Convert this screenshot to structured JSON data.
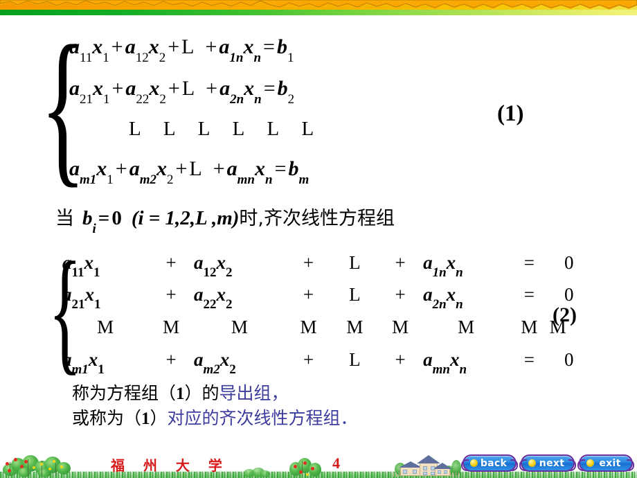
{
  "slide": {
    "page_number": "4",
    "footer_university": "福 州 大 学",
    "accent_blue": "#3d3d9e",
    "accent_red": "#d71a1a"
  },
  "system1": {
    "tag": "(1)",
    "rows": [
      {
        "a1": "a",
        "a1sub": "11",
        "x1": "x",
        "x1sub": "1",
        "op1": "+",
        "a2": "a",
        "a2sub": "12",
        "x2": "x",
        "x2sub": "2",
        "op2": "+",
        "ell": "L",
        "op3": "+",
        "a3": "a",
        "a3sub": "1n",
        "x3": "x",
        "x3sub": "n",
        "eq": "=",
        "rhs": "b",
        "rhssub": "1"
      },
      {
        "a1": "a",
        "a1sub": "21",
        "x1": "x",
        "x1sub": "1",
        "op1": "+",
        "a2": "a",
        "a2sub": "22",
        "x2": "x",
        "x2sub": "2",
        "op2": "+",
        "ell": "L",
        "op3": "+",
        "a3": "a",
        "a3sub": "2n",
        "x3": "x",
        "x3sub": "n",
        "eq": "=",
        "rhs": "b",
        "rhssub": "2"
      },
      {
        "a1": "a",
        "a1sub": "m1",
        "x1": "x",
        "x1sub": "1",
        "op1": "+",
        "a2": "a",
        "a2sub": "m2",
        "x2": "x",
        "x2sub": "2",
        "op2": "+",
        "ell": "L",
        "op3": "+",
        "a3": "a",
        "a3sub": "mn",
        "x3": "x",
        "x3sub": "n",
        "eq": "=",
        "rhs": "b",
        "rhssub": "m"
      }
    ],
    "dots_row": "L L L L L L"
  },
  "condition_line": {
    "prefix": "当",
    "b": "b",
    "bsub": "i",
    "eq": "=",
    "zero": "0",
    "range": "(i = 1,2,L ,m)",
    "suffix": "时,齐次线性方程组"
  },
  "system2": {
    "tag": "(2)",
    "rows": [
      {
        "a": "a",
        "asub": "11",
        "x": "x",
        "xsub": "1",
        "plus1": "+",
        "a2": "a",
        "a2sub": "12",
        "x2": "x",
        "x2sub": "2",
        "plus2": "+",
        "ell": "L",
        "plus3": "+",
        "an": "a",
        "ansub": "1n",
        "xn": "x",
        "xnsub": "n",
        "eq": "=",
        "rhs": "0"
      },
      {
        "a": "a",
        "asub": "21",
        "x": "x",
        "xsub": "1",
        "plus1": "+",
        "a2": "a",
        "a2sub": "22",
        "x2": "x",
        "x2sub": "2",
        "plus2": "+",
        "ell": "L",
        "plus3": "+",
        "an": "a",
        "ansub": "2n",
        "xn": "x",
        "xnsub": "n",
        "eq": "=",
        "rhs": "0"
      },
      {
        "a": "a",
        "asub": "m1",
        "x": "x",
        "xsub": "1",
        "plus1": "+",
        "a2": "a",
        "a2sub": "m2",
        "x2": "x",
        "x2sub": "2",
        "plus2": "+",
        "ell": "L",
        "plus3": "+",
        "an": "a",
        "ansub": "mn",
        "xn": "x",
        "xnsub": "n",
        "eq": "=",
        "rhs": "0"
      }
    ],
    "vdots": [
      "M",
      "M",
      "M",
      "M",
      "M",
      "M",
      "M",
      "M",
      "M"
    ]
  },
  "closing": {
    "line1_a": "称为方程组（",
    "line1_num": "1",
    "line1_b": "）的",
    "line1_hl": "导出组，",
    "line2_a": "或称为（",
    "line2_num": "1",
    "line2_b": "）",
    "line2_hl": "对应的齐次线性方程组．"
  },
  "nav": {
    "back": "back",
    "next": "next",
    "exit": "exit"
  }
}
